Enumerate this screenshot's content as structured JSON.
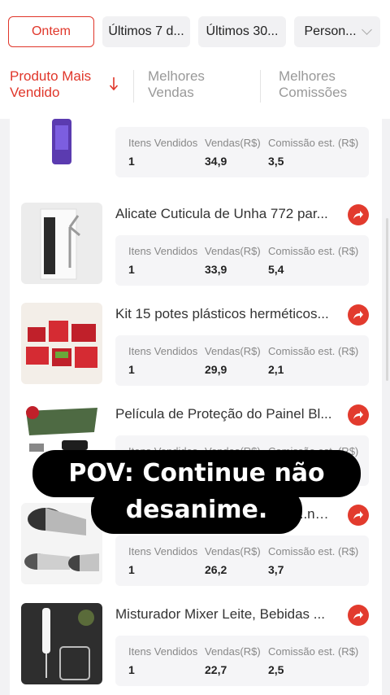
{
  "filters": {
    "chips": [
      "Ontem",
      "Últimos 7 d...",
      "Últimos 30...",
      "Person..."
    ],
    "active_index": 0
  },
  "sort_tabs": [
    {
      "label_line1": "Produto Mais",
      "label_line2": "Vendido",
      "active": true
    },
    {
      "label_line1": "Melhores",
      "label_line2": "Vendas",
      "active": false
    },
    {
      "label_line1": "Melhores",
      "label_line2": "Comissões",
      "active": false
    }
  ],
  "stat_labels": {
    "sold": "Itens Vendidos",
    "sales": "Vendas(R$)",
    "commission": "Comissão est. (R$)"
  },
  "products": [
    {
      "title": "",
      "sold": "1",
      "sales": "34,9",
      "commission": "3,5",
      "thumb": "purple-bottle-icon"
    },
    {
      "title": "Alicate Cuticula de Unha 772 par...",
      "sold": "1",
      "sales": "33,9",
      "commission": "5,4",
      "thumb": "cuticle-nipper-icon"
    },
    {
      "title": "Kit 15 potes plásticos herméticos...",
      "sold": "1",
      "sales": "29,9",
      "commission": "2,1",
      "thumb": "red-containers-icon"
    },
    {
      "title": "Película de Proteção do Painel Bl...",
      "sold": "",
      "sales": "",
      "commission": "",
      "thumb": "dashboard-film-icon"
    },
    {
      "title": "...nox ...",
      "sold": "1",
      "sales": "26,2",
      "commission": "3,7",
      "thumb": "exhaust-tip-icon"
    },
    {
      "title": "Misturador Mixer Leite, Bebidas ...",
      "sold": "1",
      "sales": "22,7",
      "commission": "2,5",
      "thumb": "milk-frother-icon"
    }
  ],
  "overlay": {
    "line1": "POV: Continue não",
    "line2": "desanime."
  },
  "colors": {
    "accent": "#e0362a",
    "share": "#e23b2e"
  }
}
